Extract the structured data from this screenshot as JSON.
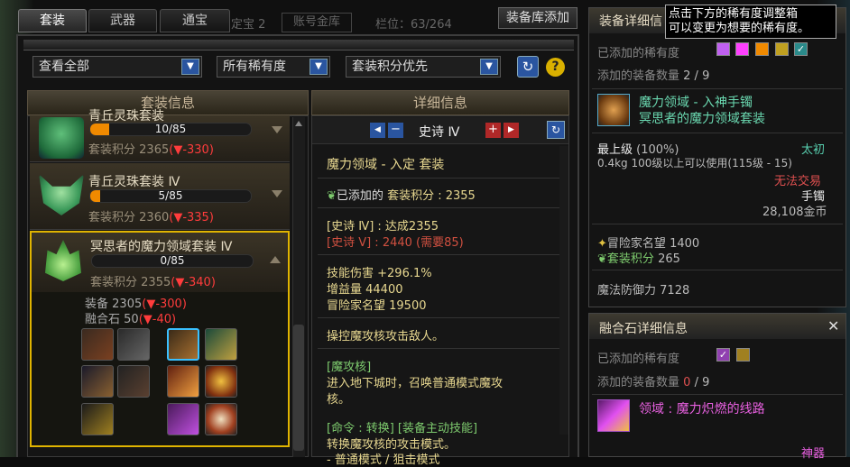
{
  "tabs": [
    {
      "label": "套装"
    },
    {
      "label": "武器"
    },
    {
      "label": "通宝"
    }
  ],
  "bg_header": {
    "left": "定宝 2",
    "mid": "账号金库",
    "slots": "栏位：63/264"
  },
  "top_button": "装备库添加",
  "filters": {
    "view": "查看全部",
    "rarity": "所有稀有度",
    "sort": "套装积分优先"
  },
  "left_header": "套装信息",
  "sets": [
    {
      "name": "青丘灵珠套装",
      "progress_text": "10/85",
      "progress": 0.118,
      "score_label": "套装积分",
      "score": "2365",
      "delta": "(▼-330)"
    },
    {
      "name": "青丘灵珠套装 Ⅳ",
      "progress_text": "5/85",
      "progress": 0.059,
      "score_label": "套装积分",
      "score": "2360",
      "delta": "(▼-335)"
    },
    {
      "name": "冥思者的魔力领域套装 Ⅳ",
      "progress_text": "0/85",
      "progress": 0,
      "score_label": "套装积分",
      "score": "2355",
      "delta": "(▼-340)"
    }
  ],
  "expanded": {
    "equip_label": "装备",
    "equip_val": "2305",
    "equip_delta": "(▼-300)",
    "fusion_label": "融合石",
    "fusion_val": "50",
    "fusion_delta": "(▼-40)"
  },
  "detail": {
    "header": "详细信息",
    "tier": "史诗 Ⅳ",
    "title": "魔力领域 - 入定 套装",
    "added_label": "已添加的",
    "added_score": "套装积分 : 2355",
    "epic4": "[史诗 Ⅳ] : 达成2355",
    "epic5": "[史诗 Ⅴ] : 2440 (需要85)",
    "stats": [
      "技能伤害 +296.1%",
      "增益量 44400",
      "冒险家名望 19500"
    ],
    "desc": "操控魔攻核攻击敌人。",
    "sub_title": "[魔攻核]",
    "sub_desc1": "进入地下城时，召唤普通模式魔攻",
    "sub_desc2": "核。",
    "cmd": "[命令 : 转换] [装备主动技能]",
    "cmd_desc": "转换魔攻核的攻击模式。",
    "cmd_more": "- 普通模式 / 狙击模式"
  },
  "equip_panel": {
    "title": "装备详细信",
    "tooltip1": "点击下方的稀有度调整箱",
    "tooltip2": "可以变更为想要的稀有度。",
    "rarity_label": "已添加的稀有度",
    "count_label": "添加的装备数量",
    "count": "2 / 9",
    "item_name": "魔力领域 - 入神手镯",
    "item_set": "冥思者的魔力领域套装",
    "grade": "最上级",
    "grade_pct": "(100%)",
    "grade_name": "太初",
    "weight": "0.4kg",
    "level": "100级以上可以使用(115级 - 15)",
    "trade": "无法交易",
    "type": "手镯",
    "price": "28,108金币",
    "fame_label": "冒险家名望",
    "fame": "1400",
    "set_score_label": "套装积分",
    "set_score": "265",
    "mdef_label": "魔法防御力",
    "mdef": "7128"
  },
  "fusion_panel": {
    "title": "融合石详细信息",
    "rarity_label": "已添加的稀有度",
    "count_label": "添加的装备数量",
    "count_cur": "0",
    "count_rest": "/ 9",
    "item_name": "领域 : 魔力炽燃的线路",
    "item_grade": "神器"
  }
}
